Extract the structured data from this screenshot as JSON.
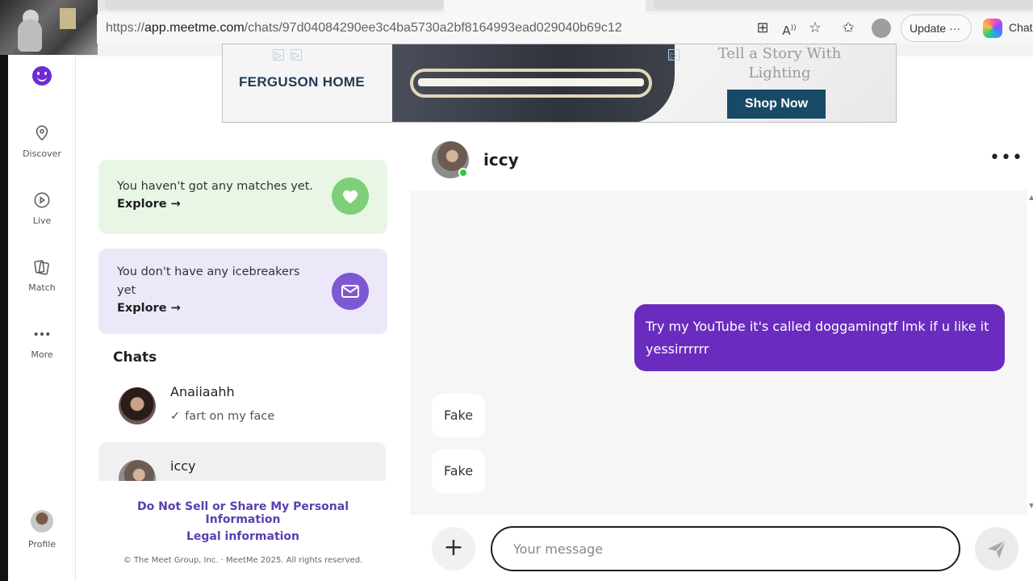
{
  "browser": {
    "url_scheme": "https://",
    "url_host": "app.meetme.com",
    "url_path": "/chats/97d04084290ee3c4ba5730a2bf8164993ead029040b69c12",
    "update_label": "Update",
    "update_menu": "···",
    "chat_label": "Chat"
  },
  "nav": {
    "items": [
      {
        "label": "Discover",
        "icon": "location-pin-icon"
      },
      {
        "label": "Live",
        "icon": "play-circle-icon"
      },
      {
        "label": "Match",
        "icon": "cards-icon"
      },
      {
        "label": "More",
        "icon": "more-dots-icon"
      }
    ],
    "profile_label": "Profile"
  },
  "ad": {
    "brand": "FERGUSON HOME",
    "tagline": "Tell a Story With Lighting",
    "cta": "Shop Now"
  },
  "panel": {
    "matches_text": "You haven't got any matches yet.",
    "matches_link": "Explore →",
    "icebreakers_text": "You don't have any icebreakers yet",
    "icebreakers_link": "Explore →",
    "chats_heading": "Chats",
    "chats": [
      {
        "name": "Anaiiaahh",
        "preview": "fart on my face",
        "read": "✓"
      },
      {
        "name": "iccy",
        "preview": ""
      }
    ],
    "footer_link_1": "Do Not Sell or Share My Personal Information",
    "footer_link_2": "Legal information",
    "copyright": "© The Meet Group, Inc. · MeetMe 2025. All rights reserved."
  },
  "conversation": {
    "name": "iccy",
    "online": true,
    "more": "•••",
    "messages": [
      {
        "direction": "out",
        "text": "Try my YouTube it's called doggamingtf lmk if u like it yessirrrrrr"
      },
      {
        "direction": "in",
        "text": "Fake"
      },
      {
        "direction": "in",
        "text": "Fake"
      }
    ],
    "composer_placeholder": "Your message",
    "add_label": "+"
  },
  "colors": {
    "accent": "#6a2bbf",
    "match_card": "#e9f6e6",
    "icebreaker_card": "#ece8fa",
    "online": "#2ecc40",
    "link": "#5b3fb0"
  }
}
